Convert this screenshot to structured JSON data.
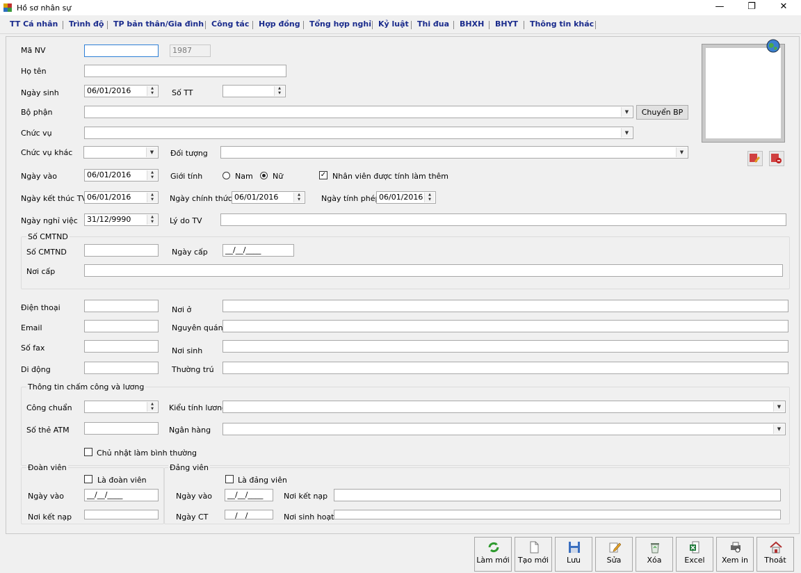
{
  "window": {
    "title": "Hồ sơ nhân sự",
    "minimize": "—",
    "restore": "❐",
    "close": "✕"
  },
  "tabs": [
    "TT Cá nhân",
    "Trình độ",
    "TP bản thân/Gia đình",
    "Công tác",
    "Hợp đồng",
    "Tổng hợp nghỉ",
    "Kỷ luật",
    "Thi đua",
    "BHXH",
    "BHYT",
    "Thông tin khác"
  ],
  "form": {
    "ma_nv": {
      "label": "Mã NV",
      "value": "",
      "extra": "1987"
    },
    "ho_ten": {
      "label": "Họ tên",
      "value": ""
    },
    "ngay_sinh": {
      "label": "Ngày sinh",
      "value": "06/01/2016"
    },
    "so_tt": {
      "label": "Số TT",
      "value": ""
    },
    "bo_phan": {
      "label": "Bộ phận",
      "value": "",
      "button": "Chuyển BP"
    },
    "chuc_vu": {
      "label": "Chức vụ",
      "value": ""
    },
    "chuc_vu_khac": {
      "label": "Chức vụ khác",
      "value": ""
    },
    "doi_tuong": {
      "label": "Đối tượng",
      "value": ""
    },
    "ngay_vao": {
      "label": "Ngày vào",
      "value": "06/01/2016"
    },
    "gioi_tinh": {
      "label": "Giới tính",
      "nam": "Nam",
      "nu": "Nữ",
      "selected": "Nữ"
    },
    "lam_them": {
      "label": "Nhân viên được tính làm thêm",
      "checked": true
    },
    "ngay_ket_thuc_tv": {
      "label": "Ngày kết thúc TV",
      "value": "06/01/2016"
    },
    "ngay_chinh_thuc": {
      "label": "Ngày chính thức",
      "value": "06/01/2016"
    },
    "ngay_tinh_phep": {
      "label": "Ngày tính phép",
      "value": "06/01/2016"
    },
    "ngay_nghi_viec": {
      "label": "Ngày nghỉ việc",
      "value": "31/12/9990"
    },
    "ly_do_tv": {
      "label": "Lý do TV",
      "value": ""
    }
  },
  "cmtnd": {
    "group": "Số CMTND",
    "so": {
      "label": "Số CMTND",
      "value": ""
    },
    "ngay_cap": {
      "label": "Ngày cấp",
      "value": "__/__/____"
    },
    "noi_cap": {
      "label": "Nơi cấp",
      "value": ""
    }
  },
  "contact": {
    "dien_thoai": "Điện thoại",
    "email": "Email",
    "so_fax": "Số fax",
    "di_dong": "Di động",
    "noi_o": "Nơi ở",
    "nguyen_quan": "Nguyên quán",
    "noi_sinh": "Nơi sinh",
    "thuong_tru": "Thường trú"
  },
  "salary": {
    "group": "Thông tin chấm công và lương",
    "cong_chuan": "Công chuẩn",
    "kieu_tinh_luong": "Kiểu tính lương",
    "so_the_atm": "Số thẻ ATM",
    "ngan_hang": "Ngân hàng",
    "chu_nhat": "Chủ nhật làm bình thường"
  },
  "doan_vien": {
    "group": "Đoàn viên",
    "check": "Là đoàn viên",
    "ngay_vao": "Ngày vào",
    "ngay_vao_value": "__/__/____",
    "noi_ket_nap": "Nơi kết nạp"
  },
  "dang_vien": {
    "group": "Đảng viên",
    "check": "Là đảng viên",
    "ngay_vao": "Ngày vào",
    "ngay_vao_value": "__/__/____",
    "noi_ket_nap": "Nơi kết nạp",
    "ngay_ct": "Ngày CT",
    "ngay_ct_value": "__/__/____",
    "noi_sinh_hoat": "Nơi sinh hoạt"
  },
  "toolbar": [
    "Làm mới",
    "Tạo mới",
    "Lưu",
    "Sửa",
    "Xóa",
    "Excel",
    "Xem in",
    "Thoát"
  ],
  "colors": {
    "tab_text": "#1a2b8c",
    "focus_border": "#2d7fd6"
  }
}
